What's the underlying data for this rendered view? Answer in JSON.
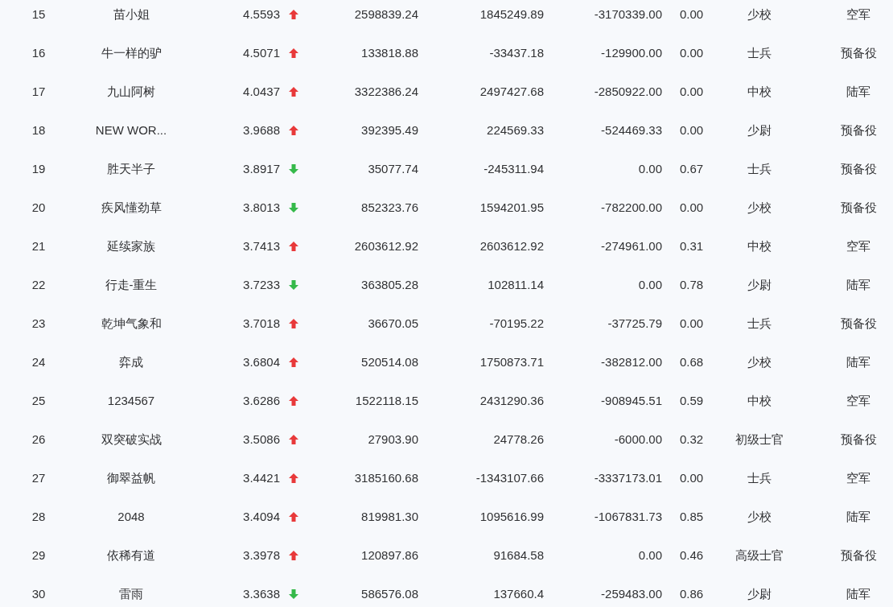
{
  "table": {
    "rows": [
      {
        "column_1": "15",
        "column_2": "苗小姐",
        "column_3": "4.5593",
        "up": true,
        "column_4": "2598839.24",
        "column_5": "1845249.89",
        "column_6": "-3170339.00",
        "column_7": "0.00",
        "column_8": "少校",
        "column_9": "空军"
      },
      {
        "column_1": "16",
        "column_2": "牛一样的驴",
        "column_3": "4.5071",
        "up": true,
        "column_4": "133818.88",
        "column_5": "-33437.18",
        "column_6": "-129900.00",
        "column_7": "0.00",
        "column_8": "士兵",
        "column_9": "预备役"
      },
      {
        "column_1": "17",
        "column_2": "九山阿树",
        "column_3": "4.0437",
        "up": true,
        "column_4": "3322386.24",
        "column_5": "2497427.68",
        "column_6": "-2850922.00",
        "column_7": "0.00",
        "column_8": "中校",
        "column_9": "陆军"
      },
      {
        "column_1": "18",
        "column_2": "NEW WOR...",
        "column_3": "3.9688",
        "up": true,
        "column_4": "392395.49",
        "column_5": "224569.33",
        "column_6": "-524469.33",
        "column_7": "0.00",
        "column_8": "少尉",
        "column_9": "预备役"
      },
      {
        "column_1": "19",
        "column_2": "胜天半子",
        "column_3": "3.8917",
        "up": false,
        "column_4": "35077.74",
        "column_5": "-245311.94",
        "column_6": "0.00",
        "column_7": "0.67",
        "column_8": "士兵",
        "column_9": "预备役"
      },
      {
        "column_1": "20",
        "column_2": "疾风懂劲草",
        "column_3": "3.8013",
        "up": false,
        "column_4": "852323.76",
        "column_5": "1594201.95",
        "column_6": "-782200.00",
        "column_7": "0.00",
        "column_8": "少校",
        "column_9": "预备役"
      },
      {
        "column_1": "21",
        "column_2": "延续家族",
        "column_3": "3.7413",
        "up": true,
        "column_4": "2603612.92",
        "column_5": "2603612.92",
        "column_6": "-274961.00",
        "column_7": "0.31",
        "column_8": "中校",
        "column_9": "空军"
      },
      {
        "column_1": "22",
        "column_2": "行走-重生",
        "column_3": "3.7233",
        "up": false,
        "column_4": "363805.28",
        "column_5": "102811.14",
        "column_6": "0.00",
        "column_7": "0.78",
        "column_8": "少尉",
        "column_9": "陆军"
      },
      {
        "column_1": "23",
        "column_2": "乾坤气象和",
        "column_3": "3.7018",
        "up": true,
        "column_4": "36670.05",
        "column_5": "-70195.22",
        "column_6": "-37725.79",
        "column_7": "0.00",
        "column_8": "士兵",
        "column_9": "预备役"
      },
      {
        "column_1": "24",
        "column_2": "弈成",
        "column_3": "3.6804",
        "up": true,
        "column_4": "520514.08",
        "column_5": "1750873.71",
        "column_6": "-382812.00",
        "column_7": "0.68",
        "column_8": "少校",
        "column_9": "陆军"
      },
      {
        "column_1": "25",
        "column_2": "1234567",
        "column_3": "3.6286",
        "up": true,
        "column_4": "1522118.15",
        "column_5": "2431290.36",
        "column_6": "-908945.51",
        "column_7": "0.59",
        "column_8": "中校",
        "column_9": "空军"
      },
      {
        "column_1": "26",
        "column_2": "双突破实战",
        "column_3": "3.5086",
        "up": true,
        "column_4": "27903.90",
        "column_5": "24778.26",
        "column_6": "-6000.00",
        "column_7": "0.32",
        "column_8": "初级士官",
        "column_9": "预备役"
      },
      {
        "column_1": "27",
        "column_2": "御翠益帆",
        "column_3": "3.4421",
        "up": true,
        "column_4": "3185160.68",
        "column_5": "-1343107.66",
        "column_6": "-3337173.01",
        "column_7": "0.00",
        "column_8": "士兵",
        "column_9": "空军"
      },
      {
        "column_1": "28",
        "column_2": "2048",
        "column_3": "3.4094",
        "up": true,
        "column_4": "819981.30",
        "column_5": "1095616.99",
        "column_6": "-1067831.73",
        "column_7": "0.85",
        "column_8": "少校",
        "column_9": "陆军"
      },
      {
        "column_1": "29",
        "column_2": "依稀有道",
        "column_3": "3.3978",
        "up": true,
        "column_4": "120897.86",
        "column_5": "91684.58",
        "column_6": "0.00",
        "column_7": "0.46",
        "column_8": "高级士官",
        "column_9": "预备役"
      },
      {
        "column_1": "30",
        "column_2": "雷雨",
        "column_3": "3.3638",
        "up": false,
        "column_4": "586576.08",
        "column_5": "137660.4",
        "column_6": "-259483.00",
        "column_7": "0.86",
        "column_8": "少尉",
        "column_9": "陆军"
      }
    ]
  }
}
